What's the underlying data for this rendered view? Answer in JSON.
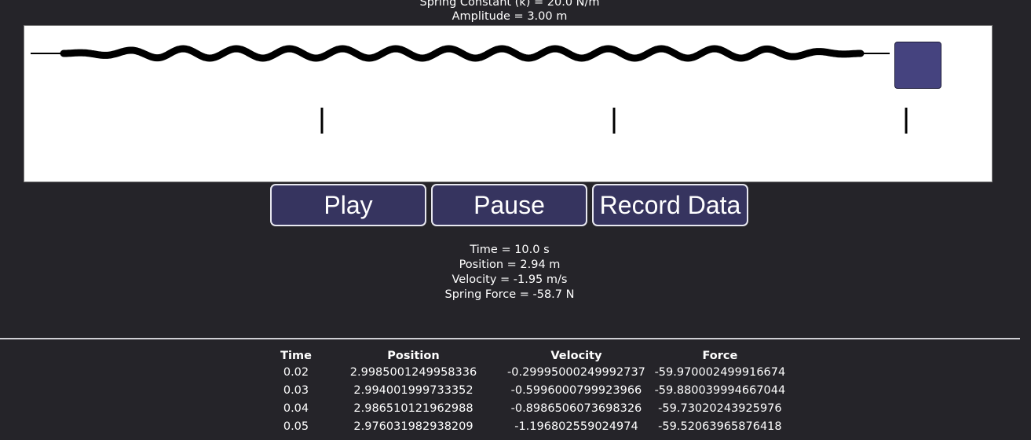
{
  "params": {
    "spring_constant": "Spring Constant (k) = 20.0 N/m",
    "amplitude": "Amplitude = 3.00 m"
  },
  "colors": {
    "mass": "#45437f",
    "button": "#36345f",
    "background": "#252429"
  },
  "buttons": {
    "play": "Play",
    "pause": "Pause",
    "record": "Record Data"
  },
  "readout": {
    "time": "Time = 10.0 s",
    "position": "Position = 2.94 m",
    "velocity": "Velocity = -1.95 m/s",
    "force": "Spring Force = -58.7 N"
  },
  "table": {
    "headers": [
      "Time",
      "Position",
      "Velocity",
      "Force"
    ],
    "rows": [
      [
        "0.02",
        "2.9985001249958336",
        "-0.29995000249992737",
        "-59.970002499916674"
      ],
      [
        "0.03",
        "2.994001999733352",
        "-0.5996000799923966",
        "-59.880039994667044"
      ],
      [
        "0.04",
        "2.986510121962988",
        "-0.8986506073698326",
        "-59.73020243925976"
      ],
      [
        "0.05",
        "2.976031982938209",
        "-1.196802559024974",
        "-59.52063965876418"
      ]
    ]
  }
}
